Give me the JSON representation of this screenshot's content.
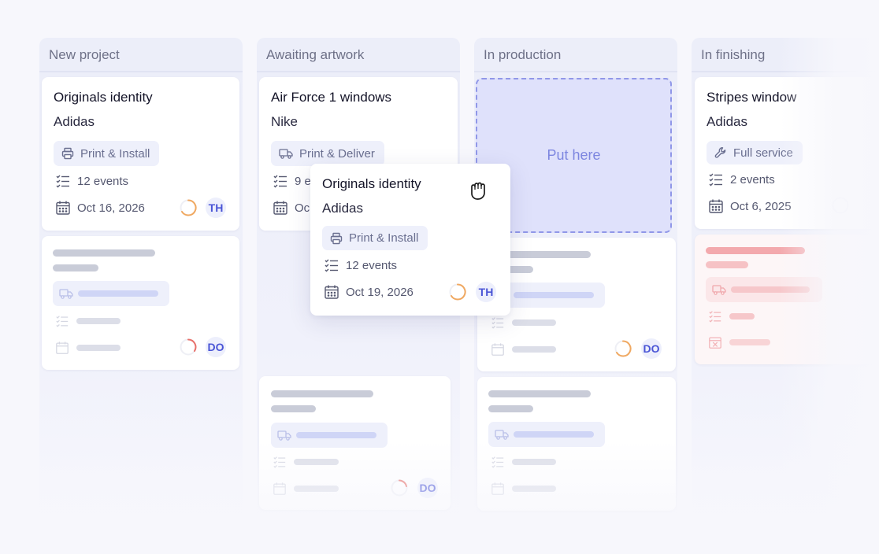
{
  "columns": [
    {
      "title": "New project"
    },
    {
      "title": "Awaiting artwork"
    },
    {
      "title": "In production"
    },
    {
      "title": "In finishing"
    }
  ],
  "cards": {
    "originals": {
      "title": "Originals identity",
      "client": "Adidas",
      "service": "Print & Install",
      "events": "12 events",
      "date": "Oct 16, 2026",
      "avatar": "TH"
    },
    "airforce": {
      "title": "Air Force 1 windows",
      "client": "Nike",
      "service": "Print & Deliver",
      "events": "9 e",
      "date": "Oc"
    },
    "stripes": {
      "title": "Stripes window",
      "client": "Adidas",
      "service": "Full service",
      "events": "2 events",
      "date": "Oct 6, 2025"
    },
    "dragging": {
      "title": "Originals identity",
      "client": "Adidas",
      "service": "Print & Install",
      "events": "12 events",
      "date": "Oct 19, 2026",
      "avatar": "TH"
    }
  },
  "skeleton_avatars": {
    "col1": "DO",
    "col2": "DO",
    "col3": "DO"
  },
  "drop_zone": {
    "label": "Put here"
  },
  "colors": {
    "accent": "#4a55d6",
    "ring_orange": "#f0a860",
    "ring_red": "#e8716b",
    "drop_border": "#9097e8"
  },
  "icons": [
    "printer-icon",
    "truck-icon",
    "wrench-icon",
    "checklist-icon",
    "calendar-icon",
    "grab-hand-icon"
  ]
}
